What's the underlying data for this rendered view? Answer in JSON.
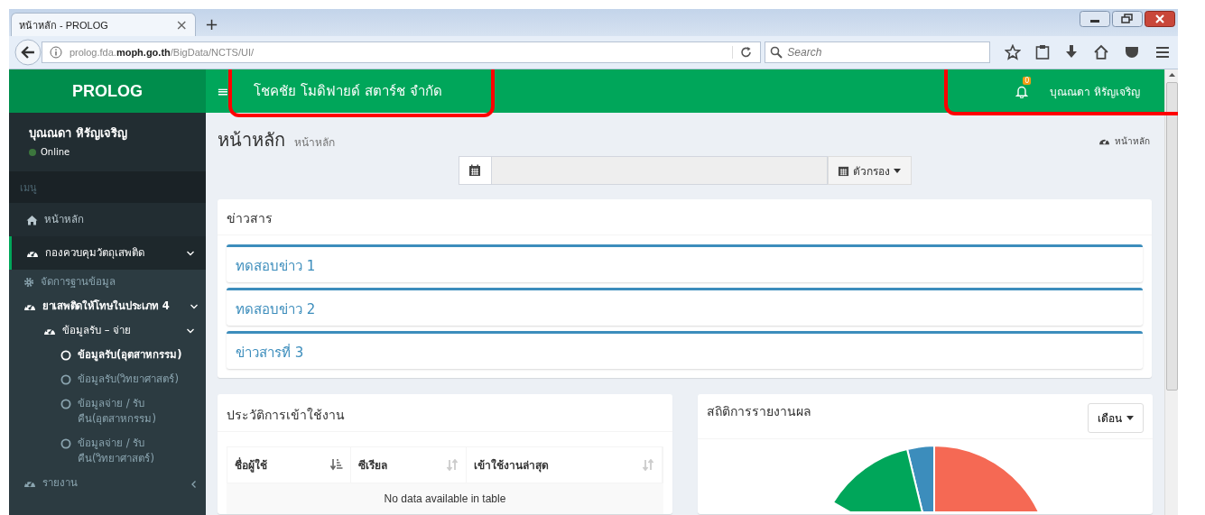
{
  "browser": {
    "tab_title": "หน้าหลัก - PROLOG",
    "tab_close": "×",
    "new_tab": "+",
    "url": "prolog.fda.**moph.go.th**/BigData/NCTS/UI/",
    "search": {
      "placeholder": "Search"
    }
  },
  "header": {
    "logo": "PROLOG",
    "menu_toggle": "≡",
    "company": "โชคชัย โมดิฟายด์ สตาร์ช จำกัด",
    "company_marked": true,
    "notification_count": "0",
    "user": "บุณณดา หิรัญเจริญ",
    "user_marked": true
  },
  "sidebar": {
    "user": {
      "name": "บุณณดา หิรัญเจริญ",
      "status": "Online",
      "online": true
    },
    "menu_header": "เมนู",
    "items": [
      {
        "label": "หน้าหลัก",
        "kind": "home",
        "selected": false
      },
      {
        "label": "กองควบคุมวัตถุเสพติด",
        "kind": "section",
        "selected": true,
        "expanded": true,
        "children": [
          {
            "label": "จัดการฐานข้อมูล",
            "kind": "settings",
            "selected": false
          },
          {
            "label": "ยาเสพติดให้โทษในประเภท 4",
            "kind": "section",
            "selected": true,
            "expanded": true,
            "children": [
              {
                "label": "ข้อมูลรับ – จ่าย",
                "kind": "section",
                "selected": true,
                "expanded": true,
                "children": [
                  {
                    "label": "ข้อมูลรับ(อุตสาหกรรม)",
                    "kind": "entry",
                    "selected": true
                  },
                  {
                    "label": "ข้อมูลรับ(วิทยาศาสตร์)",
                    "kind": "entry",
                    "selected": false
                  },
                  {
                    "label": "ข้อมูลจ่าย / รับคืน(อุตสาหกรรม)",
                    "kind": "entry",
                    "selected": false
                  },
                  {
                    "label": "ข้อมูลจ่าย / รับคืน(วิทยาศาสตร์)",
                    "kind": "entry",
                    "selected": false
                  }
                ]
              }
            ]
          },
          {
            "label": "รายงาน",
            "kind": "section",
            "selected": false,
            "expanded": false
          }
        ]
      }
    ]
  },
  "page": {
    "title": "หน้าหลัก",
    "subtitle": "หน้าหลัก",
    "breadcrumb": "หน้าหลัก",
    "filter_button": "ตัวกรอง"
  },
  "news": {
    "title": "ข่าวสาร",
    "items": [
      "ทดสอบข่าว 1",
      "ทดสอบข่าว 2",
      "ข่าวสารที่ 3"
    ]
  },
  "login_history": {
    "title": "ประวัติการเข้าใช้งาน",
    "columns": [
      {
        "label": "ชื่อผู้ใช้",
        "sorted": true
      },
      {
        "label": "ซีเรียล",
        "sorted": false
      },
      {
        "label": "เข้าใช้งานล่าสุด",
        "sorted": false
      }
    ],
    "empty_message": "No data available in table"
  },
  "report_stats": {
    "title": "สถิติการรายงานผล",
    "period_button": "เดือน"
  }
}
